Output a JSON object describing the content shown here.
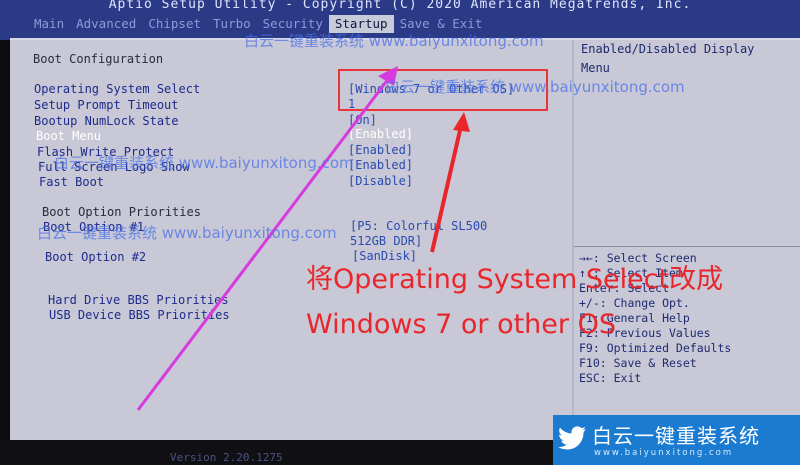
{
  "header": {
    "title": "Aptio Setup Utility - Copyright (C) 2020 American Megatrends, Inc.",
    "tabs": [
      "Main",
      "Advanced",
      "Chipset",
      "Turbo",
      "Security",
      "Startup",
      "Save & Exit"
    ],
    "active_tab": "Startup"
  },
  "boot": {
    "section_title": "Boot Configuration",
    "items": [
      {
        "label": "Operating System Select",
        "value": "[Windows 7 or Other OS]"
      },
      {
        "label": "Setup Prompt Timeout",
        "value": "1"
      },
      {
        "label": "Bootup NumLock State",
        "value": "[On]"
      },
      {
        "label": "Boot Menu",
        "value": "[Enabled]"
      },
      {
        "label": "Flash Write Protect",
        "value": "[Enabled]"
      },
      {
        "label": "Full Screen Logo Show",
        "value": "[Enabled]"
      },
      {
        "label": "Fast Boot",
        "value": "[Disable]"
      }
    ],
    "priorities_title": "Boot Option Priorities",
    "options": [
      {
        "label": "Boot Option #1",
        "value_line1": "[P5: Colorful SL500",
        "value_line2": "512GB DDR]"
      },
      {
        "label": "Boot Option #2",
        "value_line1": "[SanDisk]"
      }
    ],
    "bbs": [
      "Hard Drive BBS Priorities",
      "USB Device BBS Priorities"
    ]
  },
  "help": {
    "line1": "Enabled/Disabled Display",
    "line2": "Menu",
    "keys": [
      "→←: Select Screen",
      "↑↓: Select Item",
      "Enter: Select",
      "+/-: Change Opt.",
      "F1: General Help",
      "F2: Previous Values",
      "F9: Optimized Defaults",
      "F10: Save & Reset",
      "ESC: Exit"
    ]
  },
  "footer": {
    "version": "Version 2.20.1275"
  },
  "annotation": {
    "line1": "将Operating System Select改成",
    "line2": "Windows 7 or other OS"
  },
  "watermarks": [
    "白云一键重装系统 www.baiyunxitong.com",
    "白云一键重装系统 www.baiyunxitong.com",
    "白云一键重装系统 www.baiyunxitong.com",
    "白云一键重装系统 www.baiyunxitong.com"
  ],
  "brand": {
    "name": "白云一键重装系统",
    "url": "www.baiyunxitong.com"
  },
  "colors": {
    "annotation": "#e8262b",
    "arrow_magenta": "#d63be0",
    "highlight_box": "#e8353a",
    "brand_blue": "#1b7bd0"
  }
}
